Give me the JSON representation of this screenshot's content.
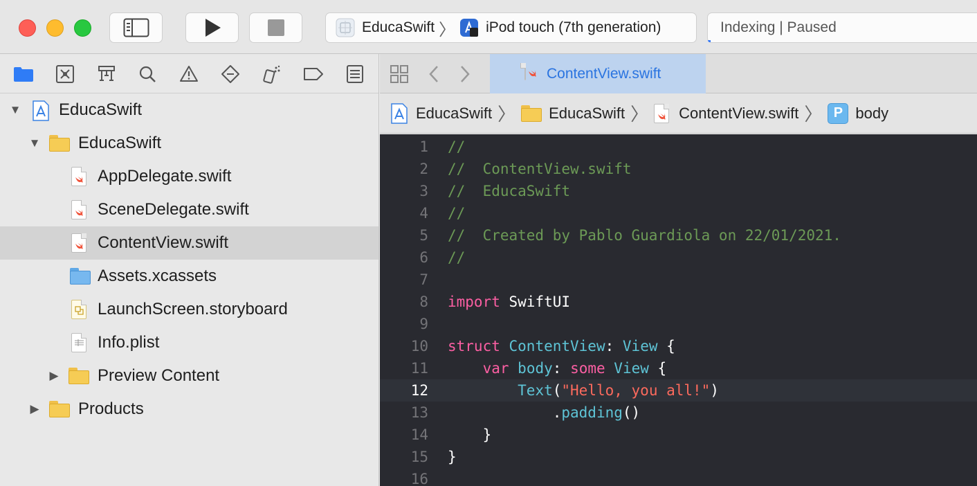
{
  "window": {
    "scheme_project": "EducaSwift",
    "scheme_device": "iPod touch (7th generation)",
    "status_text": "Indexing | Paused",
    "indexing_progress": 0.01
  },
  "navigator": {
    "tabs": [
      "folder-icon",
      "source-control-icon",
      "symbol-hierarchy-icon",
      "search-icon",
      "warning-icon",
      "test-icon",
      "debug-icon",
      "breakpoint-icon",
      "report-icon"
    ],
    "tree": [
      {
        "label": "EducaSwift",
        "level": 0,
        "expanded": true,
        "icon": "project-icon"
      },
      {
        "label": "EducaSwift",
        "level": 1,
        "expanded": true,
        "icon": "folder-icon"
      },
      {
        "label": "AppDelegate.swift",
        "level": 2,
        "icon": "swift-file-icon"
      },
      {
        "label": "SceneDelegate.swift",
        "level": 2,
        "icon": "swift-file-icon"
      },
      {
        "label": "ContentView.swift",
        "level": 2,
        "icon": "swift-file-icon",
        "selected": true
      },
      {
        "label": "Assets.xcassets",
        "level": 2,
        "icon": "asset-catalog-icon"
      },
      {
        "label": "LaunchScreen.storyboard",
        "level": 2,
        "icon": "storyboard-icon"
      },
      {
        "label": "Info.plist",
        "level": 2,
        "icon": "plist-icon"
      },
      {
        "label": "Preview Content",
        "level": 2,
        "expanded": false,
        "icon": "folder-icon"
      },
      {
        "label": "Products",
        "level": 1,
        "expanded": false,
        "icon": "folder-icon"
      }
    ]
  },
  "editor": {
    "tab_title": "ContentView.swift",
    "jumpbar": [
      "EducaSwift",
      "EducaSwift",
      "ContentView.swift",
      "body"
    ],
    "current_line": 12,
    "lines": [
      {
        "n": "1",
        "text": "//"
      },
      {
        "n": "2",
        "text": "//  ContentView.swift"
      },
      {
        "n": "3",
        "text": "//  EducaSwift"
      },
      {
        "n": "4",
        "text": "//"
      },
      {
        "n": "5",
        "text": "//  Created by Pablo Guardiola on 22/01/2021."
      },
      {
        "n": "6",
        "text": "//"
      },
      {
        "n": "7",
        "text": ""
      },
      {
        "n": "8",
        "text": "import SwiftUI"
      },
      {
        "n": "9",
        "text": ""
      },
      {
        "n": "10",
        "text": "struct ContentView: View {"
      },
      {
        "n": "11",
        "text": "    var body: some View {"
      },
      {
        "n": "12",
        "text": "        Text(\"Hello, you all!\")"
      },
      {
        "n": "13",
        "text": "            .padding()"
      },
      {
        "n": "14",
        "text": "    }"
      },
      {
        "n": "15",
        "text": "}"
      },
      {
        "n": "16",
        "text": ""
      }
    ]
  },
  "colors": {
    "accent": "#2a74e0",
    "comment": "#6c9a56",
    "keyword": "#fc5fa3",
    "type": "#5dd8ff",
    "string": "#fc6a5d",
    "editor_bg": "#292a30"
  }
}
